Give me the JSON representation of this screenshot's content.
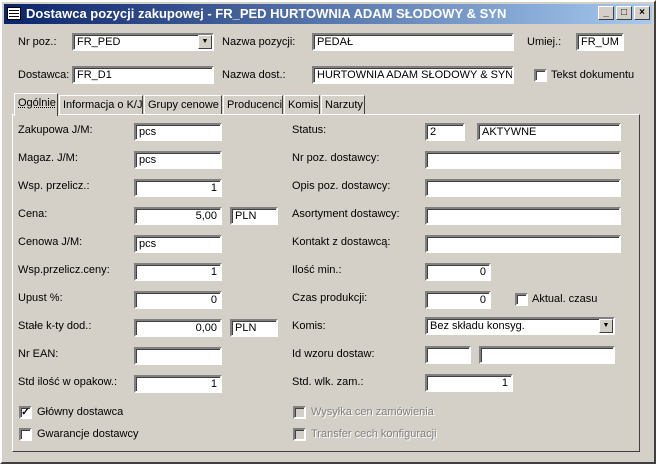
{
  "window": {
    "title": "Dostawca pozycji zakupowej - FR_PED HURTOWNIA ADAM SŁODOWY & SYN",
    "minimize": "_",
    "maximize": "□",
    "close": "×"
  },
  "header": {
    "nr_poz_label": "Nr poz.:",
    "nr_poz_value": "FR_PED",
    "nazwa_pozycji_label": "Nazwa pozycji:",
    "nazwa_pozycji_value": "PEDAŁ",
    "umiej_label": "Umiej.:",
    "umiej_value": "FR_UM",
    "dostawca_label": "Dostawca:",
    "dostawca_value": "FR_D1",
    "nazwa_dost_label": "Nazwa dost.:",
    "nazwa_dost_value": "HURTOWNIA ADAM SŁODOWY & SYN",
    "tekst_dokumentu_label": "Tekst dokumentu",
    "tekst_dokumentu_checked": false
  },
  "tabs": [
    {
      "label": "Ogólnie",
      "active": true
    },
    {
      "label": "Informacja o K/J"
    },
    {
      "label": "Grupy cenowe"
    },
    {
      "label": "Producenci"
    },
    {
      "label": "Komis"
    },
    {
      "label": "Narzuty"
    }
  ],
  "left": {
    "zakupowa_jm": {
      "label": "Zakupowa J/M:",
      "value": "pcs"
    },
    "magaz_jm": {
      "label": "Magaz. J/M:",
      "value": "pcs"
    },
    "wsp_przelicz": {
      "label": "Wsp. przelicz.:",
      "value": "1"
    },
    "cena": {
      "label": "Cena:",
      "value": "5,00",
      "currency": "PLN"
    },
    "cenowa_jm": {
      "label": "Cenowa J/M:",
      "value": "pcs"
    },
    "wsp_przelicz_ceny": {
      "label": "Wsp.przelicz.ceny:",
      "value": "1"
    },
    "upust": {
      "label": "Upust %:",
      "value": "0"
    },
    "stale_kty": {
      "label": "Stałe k-ty dod.:",
      "value": "0,00",
      "currency": "PLN"
    },
    "nr_ean": {
      "label": "Nr EAN:",
      "value": ""
    },
    "std_ilosc": {
      "label": "Std ilość w opakow.:",
      "value": "1"
    },
    "glowny_dostawca": {
      "label": "Główny dostawca",
      "checked": true
    },
    "gwarancje_dostawcy": {
      "label": "Gwarancje dostawcy",
      "checked": false
    }
  },
  "right": {
    "status": {
      "label": "Status:",
      "code": "2",
      "text": "AKTYWNE"
    },
    "nr_poz_dostawcy": {
      "label": "Nr poz. dostawcy:",
      "value": ""
    },
    "opis_poz_dostawcy": {
      "label": "Opis poz. dostawcy:",
      "value": ""
    },
    "asortyment_dostawcy": {
      "label": "Asortyment dostawcy:",
      "value": ""
    },
    "kontakt_z_dostawca": {
      "label": "Kontakt z dostawcą:",
      "value": ""
    },
    "ilosc_min": {
      "label": "Ilość min.:",
      "value": "0"
    },
    "czas_produkcji": {
      "label": "Czas produkcji:",
      "value": "0"
    },
    "aktual_czasu": {
      "label": "Aktual. czasu",
      "checked": false
    },
    "komis": {
      "label": "Komis:",
      "value": "Bez składu konsyg."
    },
    "id_wzoru_dostaw": {
      "label": "Id wzoru dostaw:",
      "value1": "",
      "value2": ""
    },
    "std_wlk_zam": {
      "label": "Std. wlk. zam.:",
      "value": "1"
    },
    "wysylka_cen": {
      "label": "Wysyłka cen zamówienia",
      "checked": false,
      "disabled": true
    },
    "transfer_cech": {
      "label": "Transfer cech konfiguracji",
      "checked": false,
      "disabled": true
    }
  }
}
